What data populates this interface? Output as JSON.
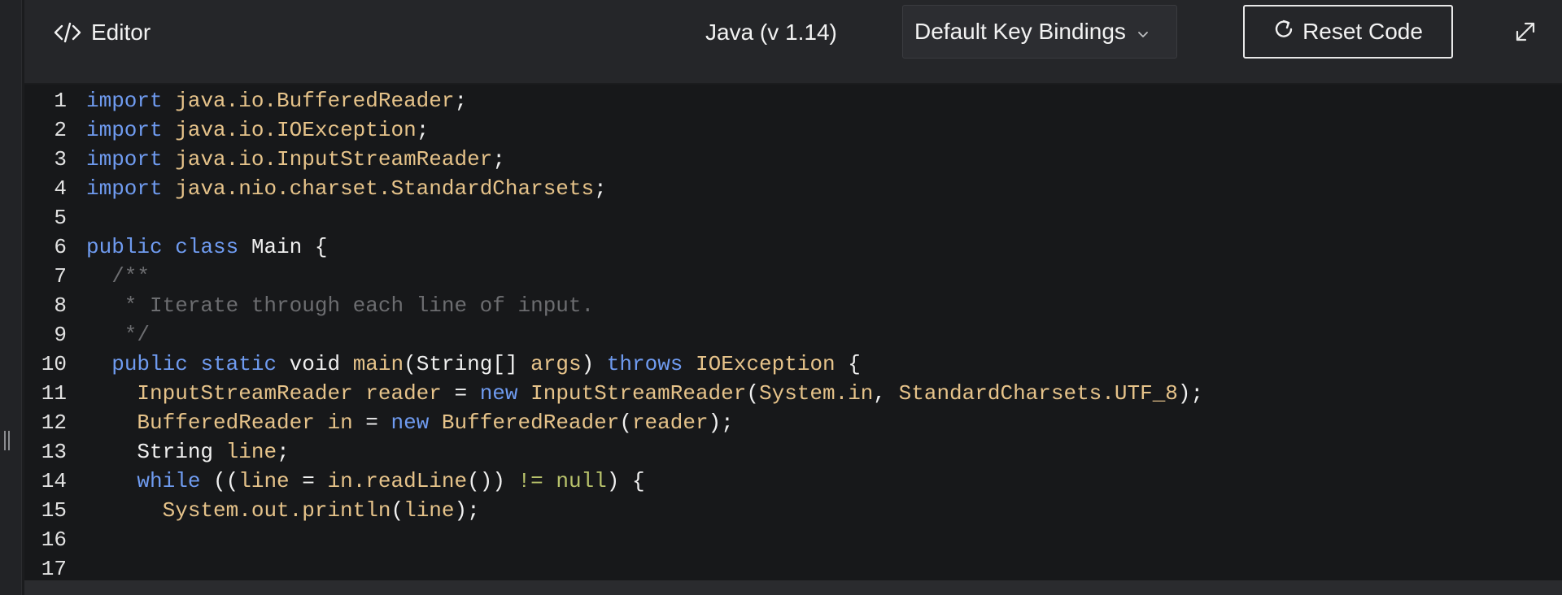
{
  "header": {
    "editor_label": "Editor",
    "language_label": "Java (v 1.14)",
    "keybindings_value": "Default Key Bindings",
    "reset_label": "Reset Code"
  },
  "icons": {
    "code": "code-icon",
    "chevron": "chevron-down-icon",
    "reset": "rotate-icon",
    "expand": "expand-icon",
    "handle": "drag-handle-icon"
  },
  "colors": {
    "keyword": "#6f9bf0",
    "type": "#e6c38a",
    "comment": "#6c6d70",
    "background": "#17181a"
  },
  "code": {
    "line_numbers": [
      "1",
      "2",
      "3",
      "4",
      "5",
      "6",
      "7",
      "8",
      "9",
      "10",
      "11",
      "12",
      "13",
      "14",
      "15",
      "16",
      "17"
    ],
    "lines": [
      [
        {
          "t": "import",
          "c": "kw"
        },
        {
          "t": " ",
          "c": "pl"
        },
        {
          "t": "java.io.BufferedReader",
          "c": "ty"
        },
        {
          "t": ";",
          "c": "pl"
        }
      ],
      [
        {
          "t": "import",
          "c": "kw"
        },
        {
          "t": " ",
          "c": "pl"
        },
        {
          "t": "java.io.IOException",
          "c": "ty"
        },
        {
          "t": ";",
          "c": "pl"
        }
      ],
      [
        {
          "t": "import",
          "c": "kw"
        },
        {
          "t": " ",
          "c": "pl"
        },
        {
          "t": "java.io.InputStreamReader",
          "c": "ty"
        },
        {
          "t": ";",
          "c": "pl"
        }
      ],
      [
        {
          "t": "import",
          "c": "kw"
        },
        {
          "t": " ",
          "c": "pl"
        },
        {
          "t": "java.nio.charset.StandardCharsets",
          "c": "ty"
        },
        {
          "t": ";",
          "c": "pl"
        }
      ],
      [],
      [
        {
          "t": "public",
          "c": "kw"
        },
        {
          "t": " ",
          "c": "pl"
        },
        {
          "t": "class",
          "c": "kw"
        },
        {
          "t": " Main {",
          "c": "pl"
        }
      ],
      [
        {
          "t": "  /**",
          "c": "cm"
        }
      ],
      [
        {
          "t": "   * Iterate through each line of input.",
          "c": "cm"
        }
      ],
      [
        {
          "t": "   */",
          "c": "cm"
        }
      ],
      [
        {
          "t": "  ",
          "c": "pl"
        },
        {
          "t": "public",
          "c": "kw"
        },
        {
          "t": " ",
          "c": "pl"
        },
        {
          "t": "static",
          "c": "kw"
        },
        {
          "t": " void ",
          "c": "pl"
        },
        {
          "t": "main",
          "c": "ty"
        },
        {
          "t": "(String[] ",
          "c": "pl"
        },
        {
          "t": "args",
          "c": "ty"
        },
        {
          "t": ") ",
          "c": "pl"
        },
        {
          "t": "throws",
          "c": "kw"
        },
        {
          "t": " ",
          "c": "pl"
        },
        {
          "t": "IOException",
          "c": "ty"
        },
        {
          "t": " {",
          "c": "pl"
        }
      ],
      [
        {
          "t": "    ",
          "c": "pl"
        },
        {
          "t": "InputStreamReader reader",
          "c": "ty"
        },
        {
          "t": " = ",
          "c": "pl"
        },
        {
          "t": "new",
          "c": "kw"
        },
        {
          "t": " ",
          "c": "pl"
        },
        {
          "t": "InputStreamReader",
          "c": "ty"
        },
        {
          "t": "(",
          "c": "pl"
        },
        {
          "t": "System.in",
          "c": "ty"
        },
        {
          "t": ", ",
          "c": "pl"
        },
        {
          "t": "StandardCharsets.UTF_8",
          "c": "ty"
        },
        {
          "t": ");",
          "c": "pl"
        }
      ],
      [
        {
          "t": "    ",
          "c": "pl"
        },
        {
          "t": "BufferedReader in",
          "c": "ty"
        },
        {
          "t": " = ",
          "c": "pl"
        },
        {
          "t": "new",
          "c": "kw"
        },
        {
          "t": " ",
          "c": "pl"
        },
        {
          "t": "BufferedReader",
          "c": "ty"
        },
        {
          "t": "(",
          "c": "pl"
        },
        {
          "t": "reader",
          "c": "ty"
        },
        {
          "t": ");",
          "c": "pl"
        }
      ],
      [
        {
          "t": "    String ",
          "c": "pl"
        },
        {
          "t": "line",
          "c": "ty"
        },
        {
          "t": ";",
          "c": "pl"
        }
      ],
      [
        {
          "t": "    ",
          "c": "pl"
        },
        {
          "t": "while",
          "c": "kw"
        },
        {
          "t": " ((",
          "c": "pl"
        },
        {
          "t": "line",
          "c": "ty"
        },
        {
          "t": " = ",
          "c": "pl"
        },
        {
          "t": "in.readLine",
          "c": "ty"
        },
        {
          "t": "()) ",
          "c": "pl"
        },
        {
          "t": "!= null",
          "c": "ky"
        },
        {
          "t": ") {",
          "c": "pl"
        }
      ],
      [
        {
          "t": "      ",
          "c": "pl"
        },
        {
          "t": "System.out.println",
          "c": "ty"
        },
        {
          "t": "(",
          "c": "pl"
        },
        {
          "t": "line",
          "c": "ty"
        },
        {
          "t": ");",
          "c": "pl"
        }
      ],
      [],
      []
    ]
  }
}
